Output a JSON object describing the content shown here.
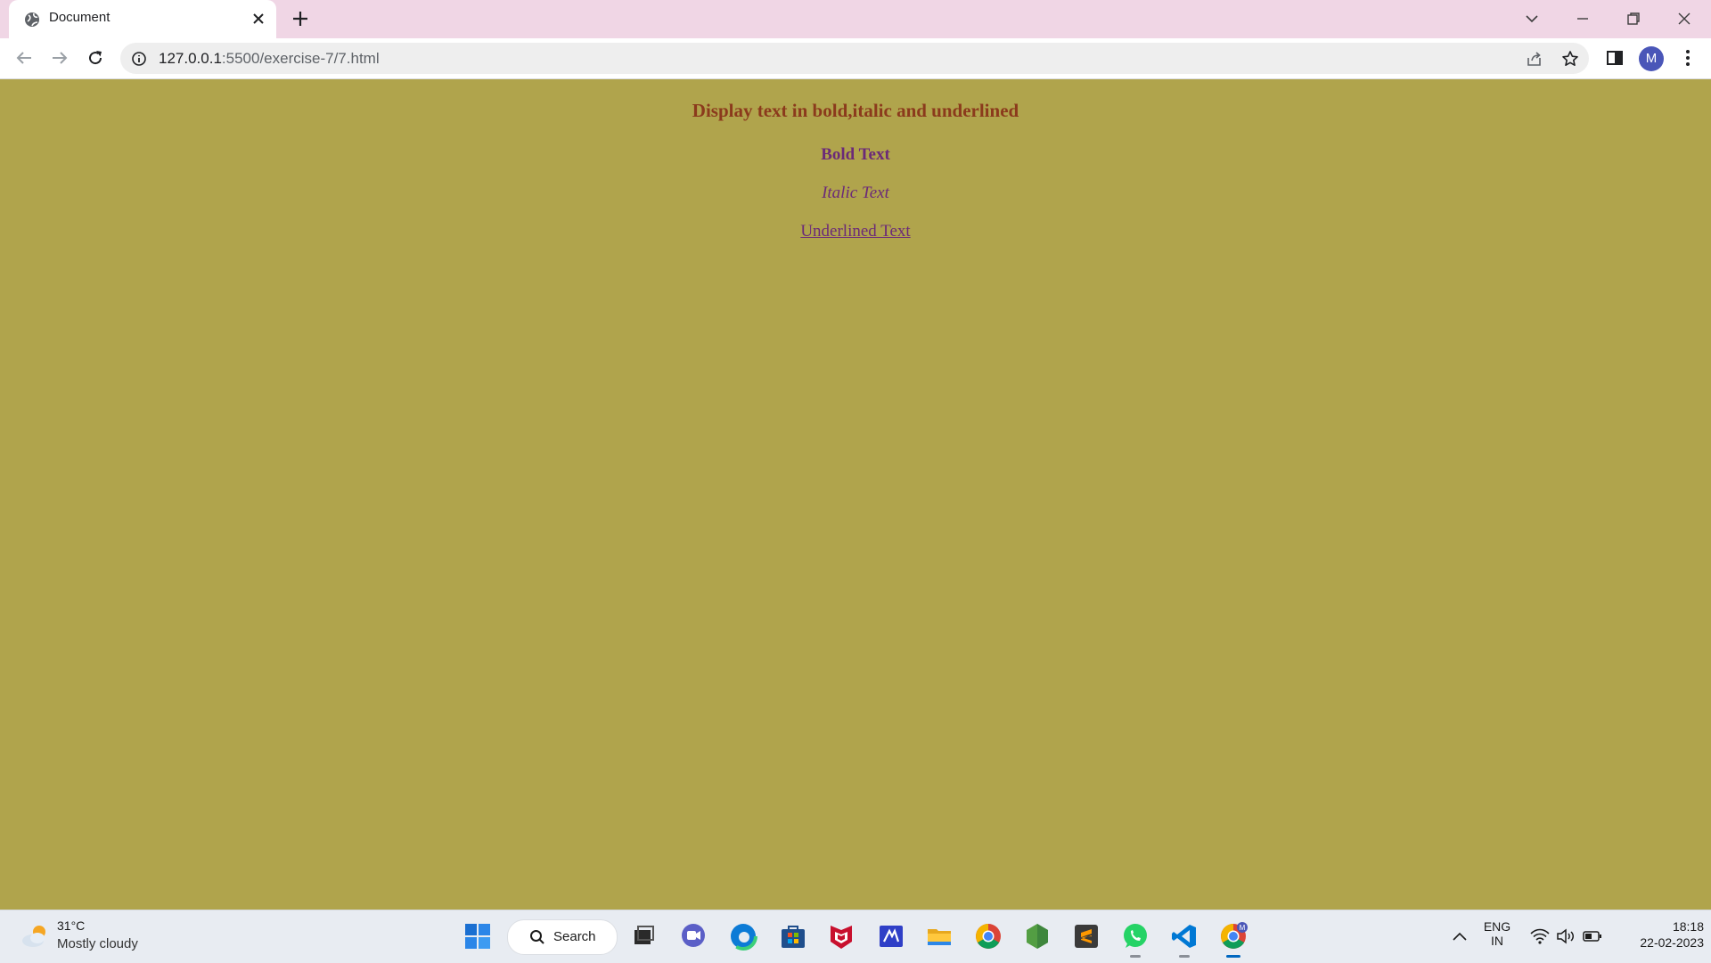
{
  "browser": {
    "tab_title": "Document",
    "url_host": "127.0.0.1",
    "url_rest": ":5500/exercise-7/7.html",
    "profile_initial": "M"
  },
  "page": {
    "heading": "Display text in bold,italic and underlined",
    "bold_text": "Bold Text",
    "italic_text": "Italic Text",
    "underlined_text": "Underlined Text",
    "background_color": "#b0a44c"
  },
  "taskbar": {
    "weather_temp": "31°C",
    "weather_condition": "Mostly cloudy",
    "search_label": "Search",
    "language_line1": "ENG",
    "language_line2": "IN",
    "time": "18:18",
    "date": "22-02-2023",
    "apps": [
      "windows-start",
      "search",
      "task-view",
      "teams-chat",
      "edge",
      "microsoft-store",
      "mcafee",
      "visual-studio",
      "file-explorer",
      "chrome",
      "nodejs",
      "sublime-text",
      "whatsapp",
      "vscode",
      "chrome-profile"
    ]
  }
}
